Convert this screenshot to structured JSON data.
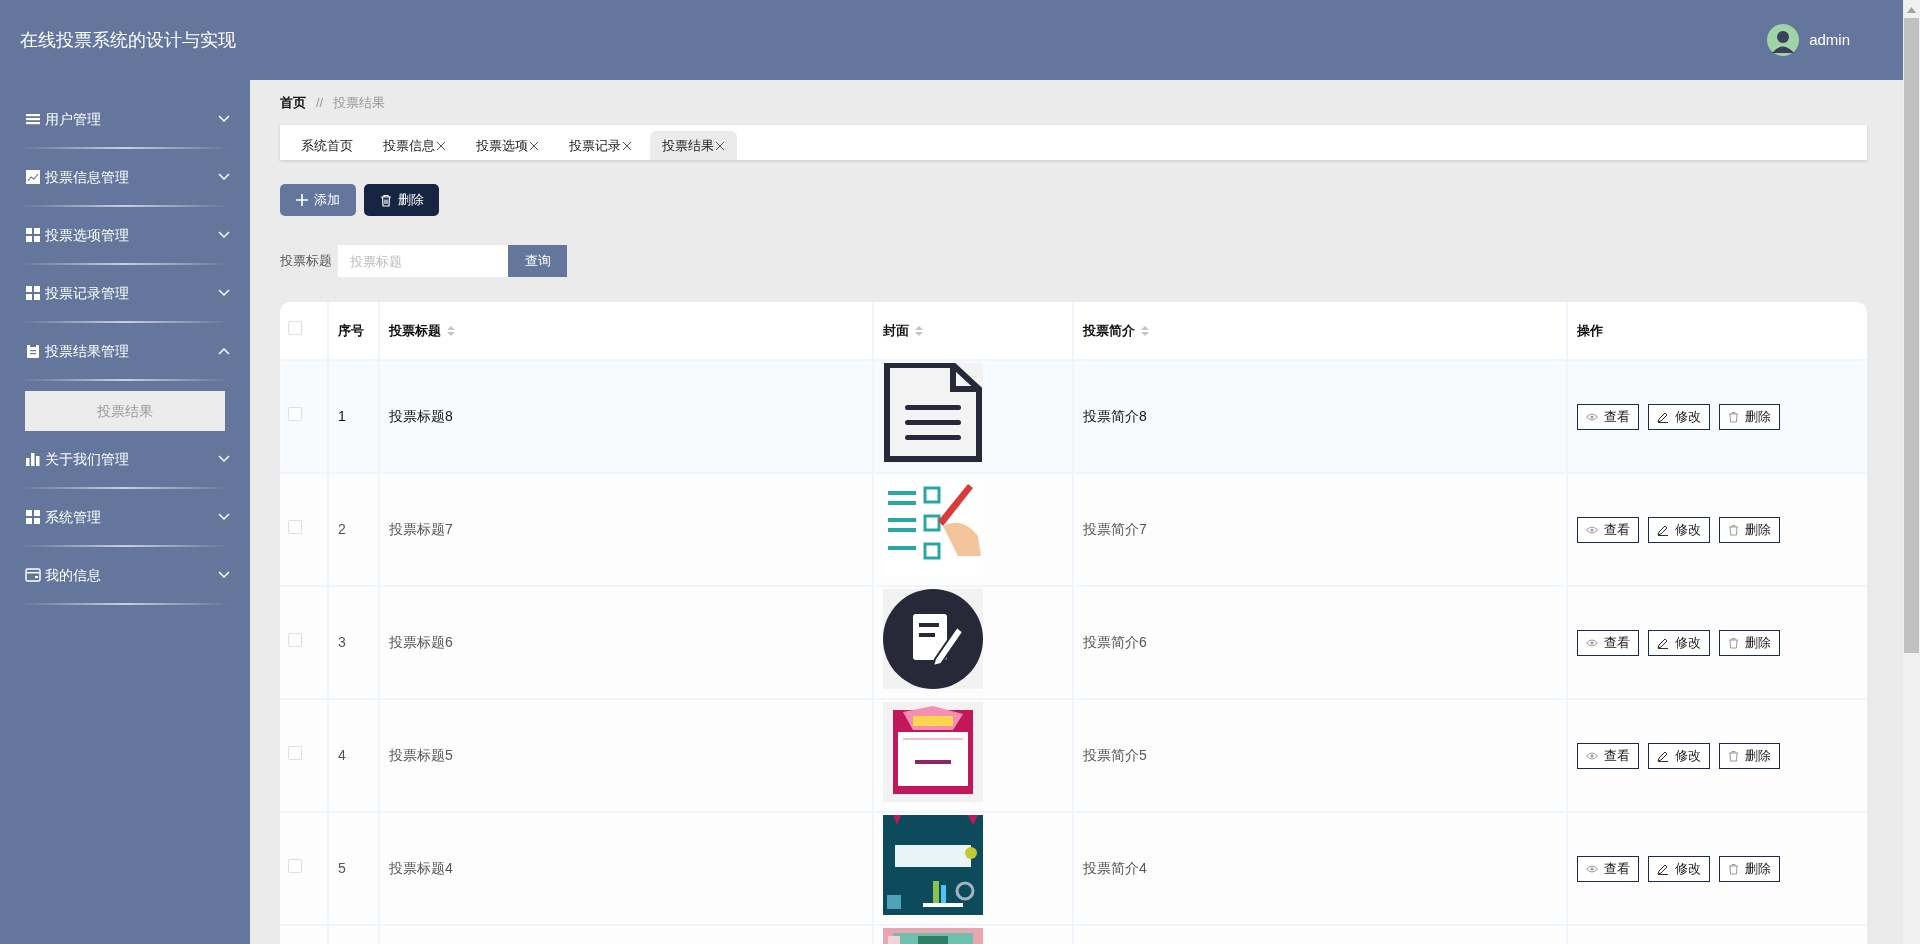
{
  "header": {
    "title": "在线投票系统的设计与实现",
    "user": "admin"
  },
  "sidebar": {
    "items": [
      {
        "label": "用户管理",
        "kind": "list",
        "expanded": false
      },
      {
        "label": "投票信息管理",
        "kind": "chart",
        "expanded": false
      },
      {
        "label": "投票选项管理",
        "kind": "grid",
        "expanded": false
      },
      {
        "label": "投票记录管理",
        "kind": "grid",
        "expanded": false
      },
      {
        "label": "投票结果管理",
        "kind": "clipboard",
        "expanded": true,
        "children": [
          {
            "label": "投票结果",
            "selected": true
          }
        ]
      },
      {
        "label": "关于我们管理",
        "kind": "bars",
        "expanded": false
      },
      {
        "label": "系统管理",
        "kind": "grid",
        "expanded": false
      },
      {
        "label": "我的信息",
        "kind": "card",
        "expanded": false
      }
    ]
  },
  "breadcrumb": {
    "home": "首页",
    "separator": "//",
    "current": "投票结果"
  },
  "tabs": [
    {
      "label": "系统首页",
      "closable": false,
      "selected": false
    },
    {
      "label": "投票信息",
      "closable": true,
      "selected": false
    },
    {
      "label": "投票选项",
      "closable": true,
      "selected": false
    },
    {
      "label": "投票记录",
      "closable": true,
      "selected": false
    },
    {
      "label": "投票结果",
      "closable": true,
      "selected": true
    }
  ],
  "toolbar": [
    {
      "label": "添加",
      "kind": "add"
    },
    {
      "label": "删除",
      "kind": "delete"
    }
  ],
  "search": {
    "label": "投票标题",
    "placeholder": "投票标题",
    "button": "查询"
  },
  "table": {
    "select_all": {
      "checked": false
    },
    "columns": [
      {
        "label": "序号",
        "sortable": false
      },
      {
        "label": "投票标题",
        "sortable": true
      },
      {
        "label": "封面",
        "sortable": true
      },
      {
        "label": "投票简介",
        "sortable": true
      },
      {
        "label": "操作",
        "sortable": false
      }
    ],
    "rows": [
      {
        "checked": false,
        "highlighted": true,
        "index": "1",
        "title": "投票标题8",
        "cover": {
          "kind": "picture"
        },
        "summary": "投票简介8",
        "actions": [
          {
            "label": "查看",
            "kind": "view"
          },
          {
            "label": "修改",
            "kind": "edit"
          },
          {
            "label": "删除",
            "kind": "delete"
          }
        ]
      },
      {
        "checked": false,
        "highlighted": false,
        "index": "2",
        "title": "投票标题7",
        "cover": {
          "kind": "picture"
        },
        "summary": "投票简介7",
        "actions": [
          {
            "label": "查看",
            "kind": "view"
          },
          {
            "label": "修改",
            "kind": "edit"
          },
          {
            "label": "删除",
            "kind": "delete"
          }
        ]
      },
      {
        "checked": false,
        "highlighted": false,
        "index": "3",
        "title": "投票标题6",
        "cover": {
          "kind": "picture"
        },
        "summary": "投票简介6",
        "actions": [
          {
            "label": "查看",
            "kind": "view"
          },
          {
            "label": "修改",
            "kind": "edit"
          },
          {
            "label": "删除",
            "kind": "delete"
          }
        ]
      },
      {
        "checked": false,
        "highlighted": false,
        "index": "4",
        "title": "投票标题5",
        "cover": {
          "kind": "picture"
        },
        "summary": "投票简介5",
        "actions": [
          {
            "label": "查看",
            "kind": "view"
          },
          {
            "label": "修改",
            "kind": "edit"
          },
          {
            "label": "删除",
            "kind": "delete"
          }
        ]
      },
      {
        "checked": false,
        "highlighted": false,
        "index": "5",
        "title": "投票标题4",
        "cover": {
          "kind": "picture"
        },
        "summary": "投票简介4",
        "actions": [
          {
            "label": "查看",
            "kind": "view"
          },
          {
            "label": "修改",
            "kind": "edit"
          },
          {
            "label": "删除",
            "kind": "delete"
          }
        ]
      },
      {
        "cover": {
          "kind": "picture"
        }
      }
    ]
  }
}
